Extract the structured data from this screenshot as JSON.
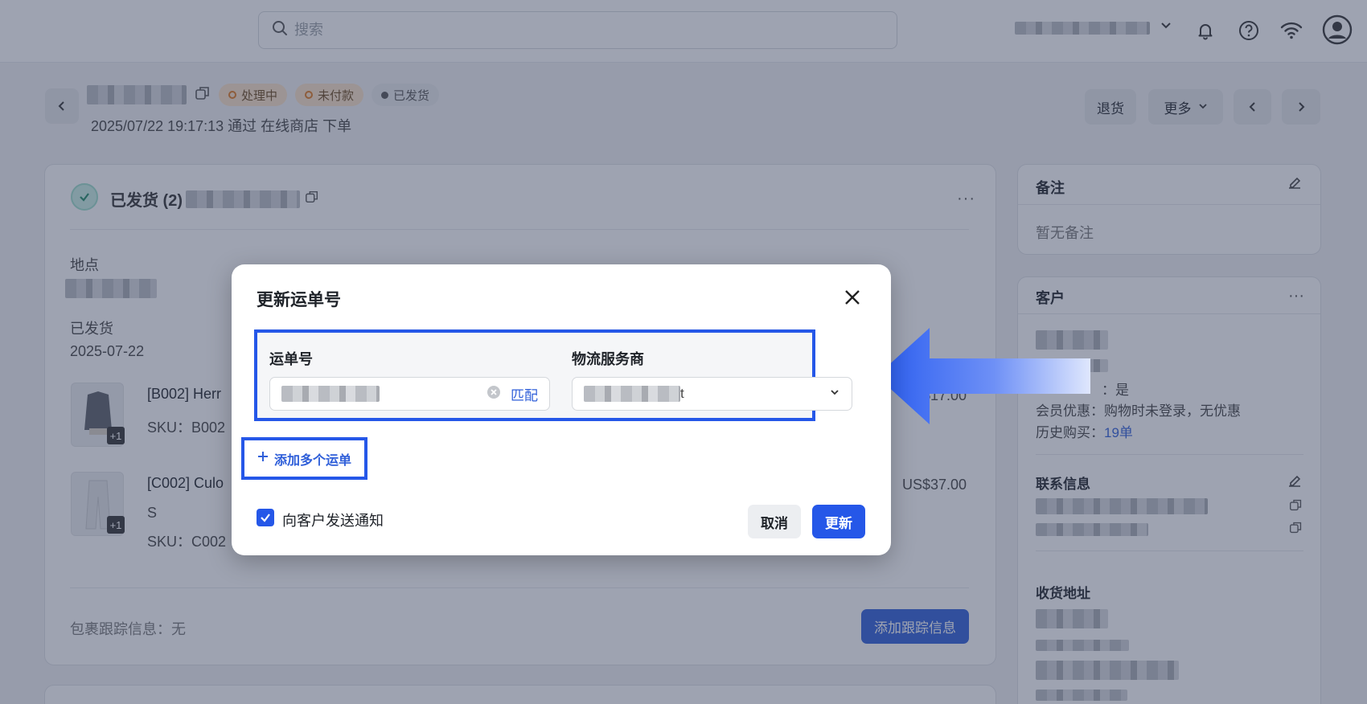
{
  "topbar": {
    "search_placeholder": "搜索"
  },
  "header": {
    "badges": [
      "处理中",
      "未付款",
      "已发货"
    ],
    "order_subtitle": "2025/07/22 19:17:13 通过 在线商店 下单",
    "return_label": "退货",
    "more_label": "更多"
  },
  "main": {
    "shipped_title": "已发货 (2)",
    "location_label": "地点",
    "shipped_label": "已发货",
    "shipped_date": "2025-07-22",
    "items": [
      {
        "name": "[B002] Herr",
        "sku": "SKU：B002",
        "price": "US$17.00",
        "variant": "",
        "more": "+1"
      },
      {
        "name": "[C002] Culo",
        "sku": "SKU：C002",
        "price": "US$37.00",
        "variant": "S",
        "more": "+1"
      }
    ],
    "tracking_info": "包裹跟踪信息：无",
    "add_tracking_label": "添加跟踪信息"
  },
  "sidebar": {
    "notes_title": "备注",
    "notes_empty": "暂无备注",
    "customer_title": "客户",
    "customer_flag_value": "：是",
    "member_discount": "会员优惠：购物时未登录，无优惠",
    "history_label": "历史购买：",
    "history_value": "19单",
    "contact_title": "联系信息",
    "address_title": "收货地址"
  },
  "modal": {
    "title": "更新运单号",
    "tracking_label": "运单号",
    "match_label": "匹配",
    "carrier_label": "物流服务商",
    "carrier_value_suffix": "t",
    "add_multiple_label": "添加多个运单",
    "notify_label": "向客户发送通知",
    "notify_checked": true,
    "cancel_label": "取消",
    "update_label": "更新"
  },
  "colors": {
    "accent": "#2557e8",
    "link": "#2f5fd9",
    "badge_orange": "#fbe3c7",
    "overlay": "#343e5c"
  }
}
